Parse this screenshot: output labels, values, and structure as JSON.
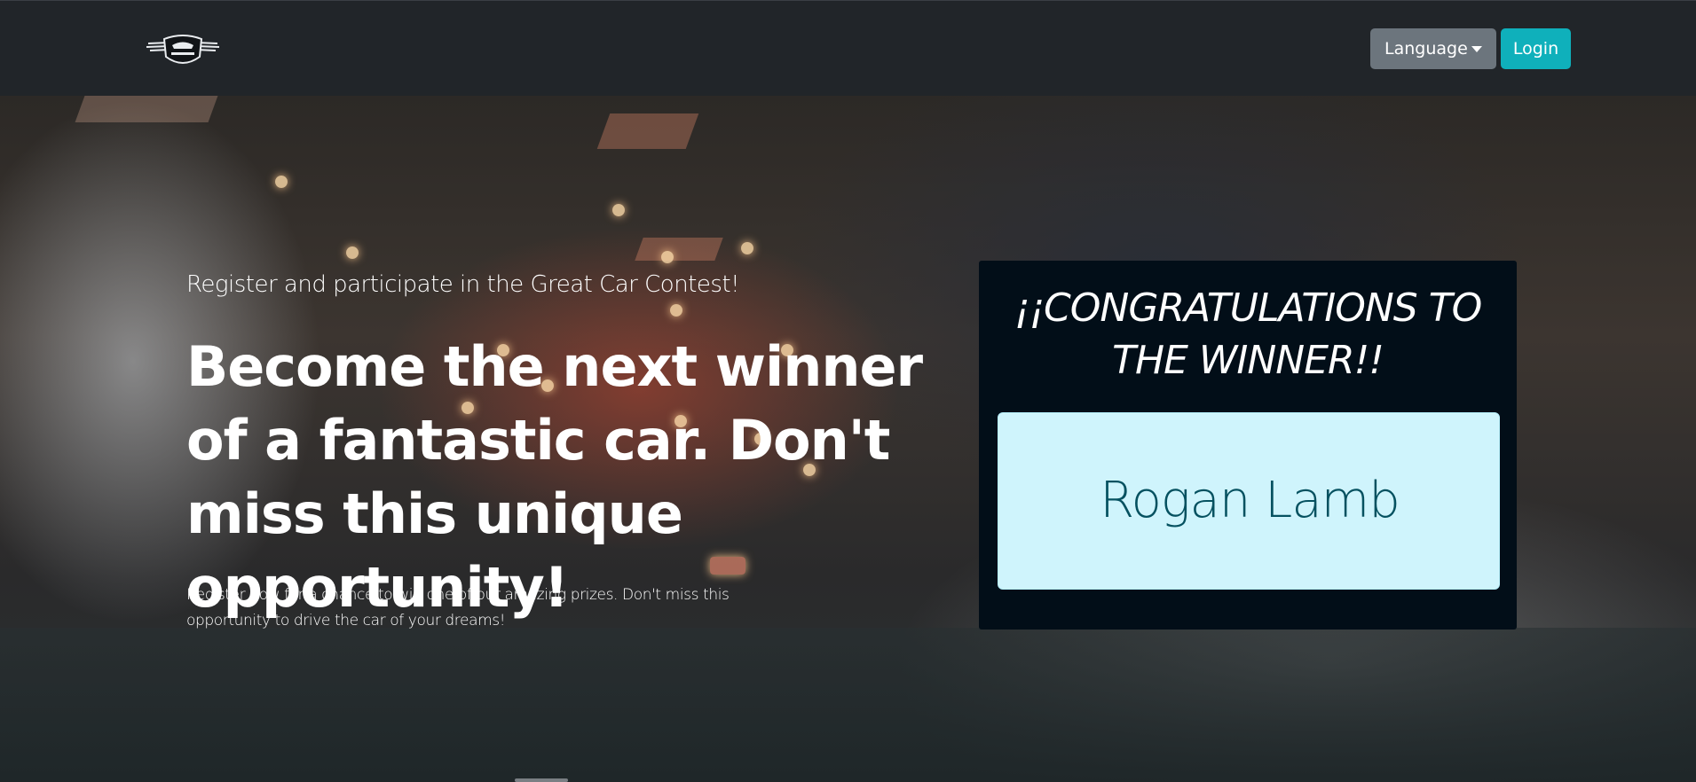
{
  "navbar": {
    "logo_alt": "Car contest logo",
    "language_label": "Language",
    "login_label": "Login"
  },
  "hero": {
    "tagline": "Register and participate in the Great Car Contest!",
    "headline": "Become the next winner of a fantastic car. Don't miss this unique opportunity!",
    "subtext": "Register now for a chance to win one of our amazing prizes. Don't miss this opportunity to drive the car of your dreams!"
  },
  "winner": {
    "title": "¡¡CONGRATULATIONS TO THE WINNER!!",
    "name": "Rogan Lamb"
  },
  "colors": {
    "navbar_bg": "#212529",
    "language_btn": "#6c757d",
    "login_btn": "#0fb0bb",
    "winner_card_bg": "#020e18",
    "winner_box_bg": "#cff4fc",
    "winner_name_text": "#055160"
  },
  "icons": {
    "logo": "winged-car-badge-icon",
    "dropdown": "caret-down-icon"
  }
}
